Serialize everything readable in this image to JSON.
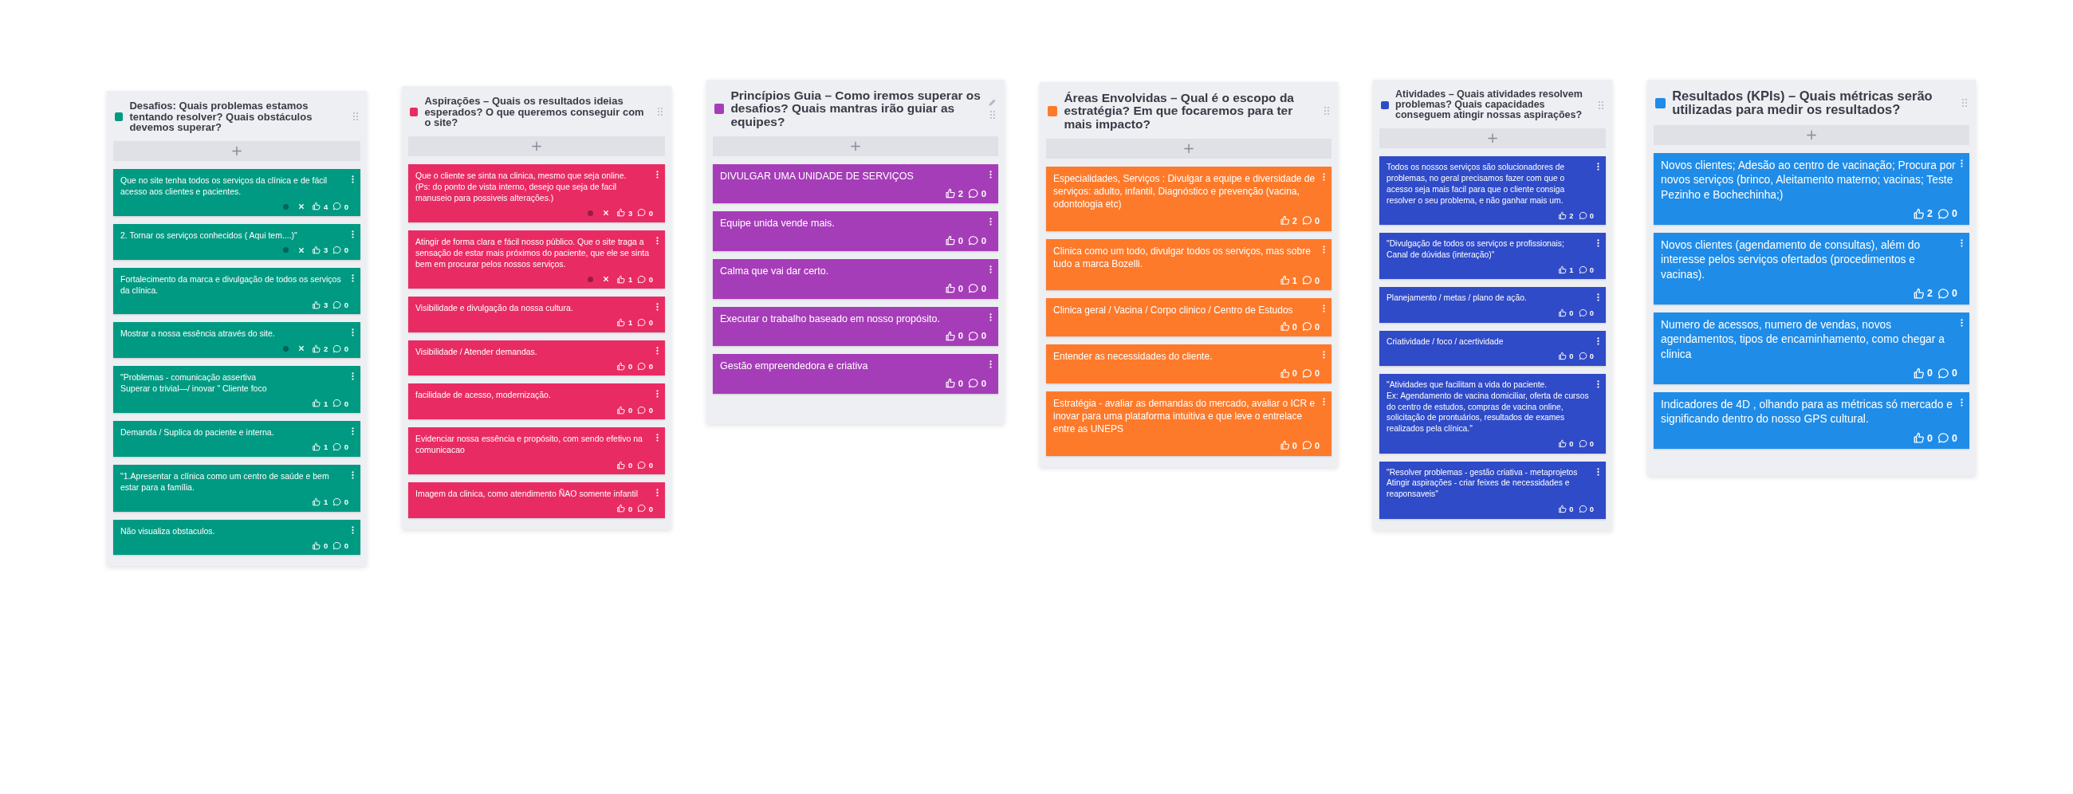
{
  "columns": [
    {
      "title": "Desafios: Quais problemas estamos tentando resolver? Quais obstáculos devemos superar?",
      "color": "#009a83",
      "editable": false,
      "add_button": "+",
      "cards": [
        {
          "text": "Que no site tenha todos os serviços da clínica e de fácil acesso aos clientes e pacientes.",
          "marked": true,
          "likes": "4",
          "comments": "0"
        },
        {
          "text": "2. Tornar os serviços conhecidos ( Aqui tem....)\"",
          "marked": true,
          "likes": "3",
          "comments": "0"
        },
        {
          "text": "Fortalecimento da marca e divulgação de todos os serviços da clínica.",
          "marked": false,
          "likes": "3",
          "comments": "0"
        },
        {
          "text": "Mostrar a nossa essência através do site.",
          "marked": true,
          "likes": "2",
          "comments": "0"
        },
        {
          "text": "\"Problemas - comunicação assertiva\nSuperar o trivial—/ inovar \" Cliente foco",
          "marked": false,
          "likes": "1",
          "comments": "0"
        },
        {
          "text": "Demanda / Suplica do paciente e interna.",
          "marked": false,
          "likes": "1",
          "comments": "0"
        },
        {
          "text": "\"1.Apresentar a clínica como um centro de saúde e bem estar para a família.",
          "marked": false,
          "likes": "1",
          "comments": "0"
        },
        {
          "text": "Não visualiza obstaculos.",
          "marked": false,
          "likes": "0",
          "comments": "0"
        }
      ]
    },
    {
      "title": "Aspirações – Quais os resultados ideias esperados? O que queremos conseguir com o site?",
      "color": "#e92b63",
      "editable": false,
      "add_button": "+",
      "cards": [
        {
          "text": "Que o cliente se sinta na clinica, mesmo que seja online.\n(Ps: do ponto de vista interno, desejo que seja de facil manuseio para possiveis alterações.)",
          "marked": true,
          "likes": "3",
          "comments": "0"
        },
        {
          "text": "Atingir de forma clara e fácil nosso público. Que o site traga a sensação de estar mais próximos do paciente, que ele se sinta bem em procurar pelos nossos serviços.",
          "marked": true,
          "likes": "1",
          "comments": "0"
        },
        {
          "text": "Visibilidade e divulgação da nossa cultura.",
          "marked": false,
          "likes": "1",
          "comments": "0"
        },
        {
          "text": "Visibilidade / Atender demandas.",
          "marked": false,
          "likes": "0",
          "comments": "0"
        },
        {
          "text": "facilidade de acesso, modernização.",
          "marked": false,
          "likes": "0",
          "comments": "0"
        },
        {
          "text": "Evidenciar nossa essência e propósito, com sendo efetivo na comunicacao",
          "marked": false,
          "likes": "0",
          "comments": "0"
        },
        {
          "text": "Imagem da clinica, como atendimento ÑAO somente infantil",
          "marked": false,
          "likes": "0",
          "comments": "0"
        }
      ]
    },
    {
      "title": "Princípios Guia – Como iremos superar os desafios? Quais mantras irão guiar as equipes?",
      "color": "#a63db8",
      "editable": true,
      "add_button": "+",
      "cards": [
        {
          "text": "DIVULGAR UMA UNIDADE DE SERVIÇOS",
          "marked": false,
          "likes": "2",
          "comments": "0"
        },
        {
          "text": "Equipe unida vende mais.",
          "marked": false,
          "likes": "0",
          "comments": "0"
        },
        {
          "text": "Calma que vai dar certo.",
          "marked": false,
          "likes": "0",
          "comments": "0"
        },
        {
          "text": "Executar o trabalho baseado em nosso propósito.",
          "marked": false,
          "likes": "0",
          "comments": "0"
        },
        {
          "text": "Gestão empreendedora e criativa",
          "marked": false,
          "likes": "0",
          "comments": "0"
        }
      ]
    },
    {
      "title": "Áreas Envolvidas – Qual é o escopo da estratégia? Em que focaremos para ter mais impacto?",
      "color": "#fd7a2b",
      "editable": false,
      "add_button": "+",
      "cards": [
        {
          "text": "Especialidades, Serviços : Divulgar a equipe e diversidade de serviços: adulto, infantil, Diagnóstico e prevenção (vacina, odontologia etc)",
          "marked": false,
          "likes": "2",
          "comments": "0"
        },
        {
          "text": "Clinica como um todo, divulgar todos os serviços, mas sobre tudo a marca Bozelli.",
          "marked": false,
          "likes": "1",
          "comments": "0"
        },
        {
          "text": "Clinica geral / Vacina / Corpo clinico / Centro de Estudos",
          "marked": false,
          "likes": "0",
          "comments": "0"
        },
        {
          "text": "Entender as necessidades do cliente.",
          "marked": false,
          "likes": "0",
          "comments": "0"
        },
        {
          "text": "Estratégia - avaliar as demandas do mercado, avaliar o ICR e inovar para uma plataforma intuitiva e que leve o entrelace entre as UNEPS",
          "marked": false,
          "likes": "0",
          "comments": "0"
        }
      ]
    },
    {
      "title": "Atividades – Quais atividades resolvem problemas? Quais capacidades conseguem atingir nossas aspirações?",
      "color": "#2f4bc8",
      "editable": false,
      "add_button": "+",
      "cards": [
        {
          "text": "Todos os nossos serviços são solucionadores de problemas, no geral precisamos fazer com que o acesso seja mais facil para que o cliente consiga resolver o seu problema, e não ganhar mais um.",
          "marked": false,
          "likes": "2",
          "comments": "0"
        },
        {
          "text": "\"Divulgação de todos os serviços e profissionais;\nCanal de dúvidas (interação)\"",
          "marked": false,
          "likes": "1",
          "comments": "0"
        },
        {
          "text": "Planejamento / metas / plano de ação.",
          "marked": false,
          "likes": "0",
          "comments": "0"
        },
        {
          "text": "Criatividade / foco / acertividade",
          "marked": false,
          "likes": "0",
          "comments": "0"
        },
        {
          "text": "\"Atividades que facilitam a vida do paciente.\nEx: Agendamento de vacina domiciliar, oferta de cursos do centro de estudos, compras de vacina online, solicitação de prontuários, resultados de exames realizados pela clínica.\"",
          "marked": false,
          "likes": "0",
          "comments": "0"
        },
        {
          "text": "\"Resolver problemas - gestão criativa - metaprojetos\nAtingir aspirações - criar feixes de necessidades e reaponsaveis\"",
          "marked": false,
          "likes": "0",
          "comments": "0"
        }
      ]
    },
    {
      "title": "Resultados (KPIs) – Quais métricas serão utilizadas para medir os resultados?",
      "color": "#1f8ce8",
      "editable": false,
      "add_button": "+",
      "cards": [
        {
          "text": "Novos clientes; Adesão ao centro de vacinação; Procura por novos serviços (brinco, Aleitamento materno; vacinas; Teste Pezinho e Bochechinha;)",
          "marked": false,
          "likes": "2",
          "comments": "0"
        },
        {
          "text": "Novos clientes (agendamento de consultas), além do interesse pelos serviços ofertados (procedimentos e vacinas).",
          "marked": false,
          "likes": "2",
          "comments": "0"
        },
        {
          "text": "Numero de acessos, numero de vendas, novos agendamentos, tipos de encaminhamento, como chegar a clinica",
          "marked": false,
          "likes": "0",
          "comments": "0"
        },
        {
          "text": "Indicadores de 4D , olhando para as métricas só mercado e significando dentro do nosso GPS cultural.",
          "marked": false,
          "likes": "0",
          "comments": "0"
        }
      ]
    }
  ]
}
